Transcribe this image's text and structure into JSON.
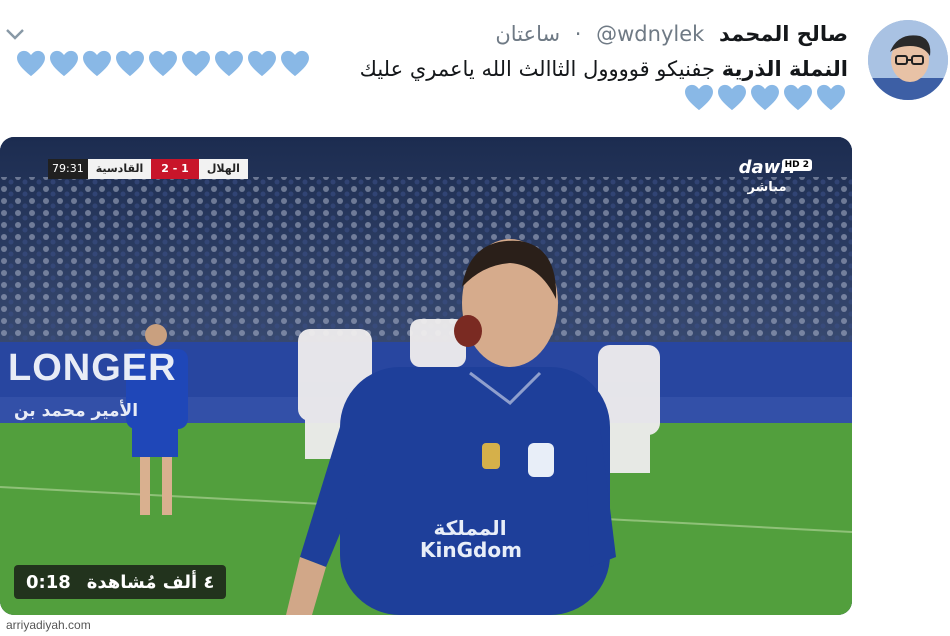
{
  "tweet": {
    "display_name": "صالح المحمد",
    "handle": "@wdnylek",
    "separator": "·",
    "time": "ساعتان",
    "text_bold": "النملة الذرية",
    "text_rest": " جفنيكو قوووول الثاالث الله ياعمري عليك",
    "heart_color": "#89b8e6",
    "hearts_line1": 9,
    "hearts_line2": 5
  },
  "video": {
    "scoreboard": {
      "time": "79:31",
      "away_team": "القادسية",
      "score": "2 - 1",
      "home_team": "الهلال"
    },
    "channel": {
      "logo": "dawri",
      "badge": "HD 2",
      "live": "مباشر"
    },
    "duration": "0:18",
    "views": "٤ ألف مُشاهدة",
    "jersey_sponsor": "المملكة KinGdom",
    "banner_text": "LONGER",
    "banner_arabic": "الأمير محمد بن"
  },
  "source_credit": "arriyadiyah.com",
  "colors": {
    "name": "#14171a",
    "muted": "#6f7a85",
    "jersey": "#1e3f9a",
    "pitch": "#4f9a3a"
  }
}
